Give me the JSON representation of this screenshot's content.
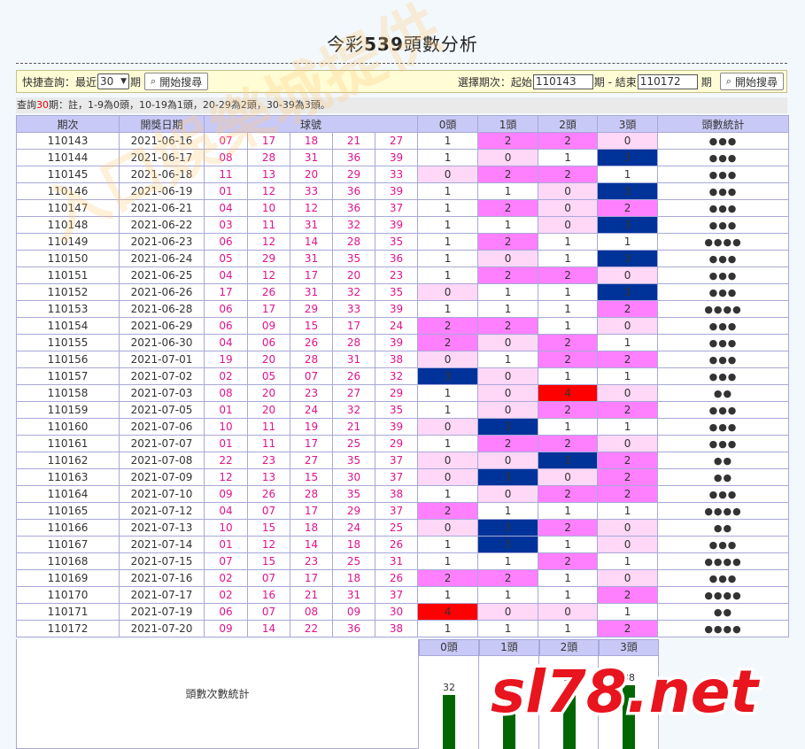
{
  "title": {
    "prefix": "今彩",
    "bold": "539",
    "suffix": "頭數分析"
  },
  "query": {
    "label": "快捷查詢：最近",
    "recent": "30",
    "unit": "期",
    "search_button": "開始搜尋",
    "range_label": "選擇期次：起始",
    "start": "110143",
    "mid_label": "期 - 結束",
    "end": "110172",
    "end_unit": "期"
  },
  "note": {
    "prefix": "查詢",
    "count": "30",
    "text": "期：註，1-9為0頭，10-19為1頭，20-29為2頭，30-39為3頭。"
  },
  "columns": [
    "期次",
    "開獎日期",
    "球號",
    "0頭",
    "1頭",
    "2頭",
    "3頭",
    "頭數統計"
  ],
  "rows": [
    {
      "period": "110143",
      "date": "2021-06-16",
      "balls": [
        "07",
        "17",
        "18",
        "21",
        "27"
      ],
      "c": [
        "1",
        "2",
        "2",
        "0"
      ],
      "s": "●●●"
    },
    {
      "period": "110144",
      "date": "2021-06-17",
      "balls": [
        "08",
        "28",
        "31",
        "36",
        "39"
      ],
      "c": [
        "1",
        "0",
        "1",
        "3"
      ],
      "s": "●●●"
    },
    {
      "period": "110145",
      "date": "2021-06-18",
      "balls": [
        "11",
        "13",
        "20",
        "29",
        "33"
      ],
      "c": [
        "0",
        "2",
        "2",
        "1"
      ],
      "s": "●●●"
    },
    {
      "period": "110146",
      "date": "2021-06-19",
      "balls": [
        "01",
        "12",
        "33",
        "36",
        "39"
      ],
      "c": [
        "1",
        "1",
        "0",
        "3"
      ],
      "s": "●●●"
    },
    {
      "period": "110147",
      "date": "2021-06-21",
      "balls": [
        "04",
        "10",
        "12",
        "36",
        "37"
      ],
      "c": [
        "1",
        "2",
        "0",
        "2"
      ],
      "s": "●●●"
    },
    {
      "period": "110148",
      "date": "2021-06-22",
      "balls": [
        "03",
        "11",
        "31",
        "32",
        "39"
      ],
      "c": [
        "1",
        "1",
        "0",
        "3"
      ],
      "s": "●●●"
    },
    {
      "period": "110149",
      "date": "2021-06-23",
      "balls": [
        "06",
        "12",
        "14",
        "28",
        "35"
      ],
      "c": [
        "1",
        "2",
        "1",
        "1"
      ],
      "s": "●●●●"
    },
    {
      "period": "110150",
      "date": "2021-06-24",
      "balls": [
        "05",
        "29",
        "31",
        "35",
        "36"
      ],
      "c": [
        "1",
        "0",
        "1",
        "3"
      ],
      "s": "●●●"
    },
    {
      "period": "110151",
      "date": "2021-06-25",
      "balls": [
        "04",
        "12",
        "17",
        "20",
        "23"
      ],
      "c": [
        "1",
        "2",
        "2",
        "0"
      ],
      "s": "●●●"
    },
    {
      "period": "110152",
      "date": "2021-06-26",
      "balls": [
        "17",
        "26",
        "31",
        "32",
        "35"
      ],
      "c": [
        "0",
        "1",
        "1",
        "3"
      ],
      "s": "●●●"
    },
    {
      "period": "110153",
      "date": "2021-06-28",
      "balls": [
        "06",
        "17",
        "29",
        "33",
        "39"
      ],
      "c": [
        "1",
        "1",
        "1",
        "2"
      ],
      "s": "●●●●"
    },
    {
      "period": "110154",
      "date": "2021-06-29",
      "balls": [
        "06",
        "09",
        "15",
        "17",
        "24"
      ],
      "c": [
        "2",
        "2",
        "1",
        "0"
      ],
      "s": "●●●"
    },
    {
      "period": "110155",
      "date": "2021-06-30",
      "balls": [
        "04",
        "06",
        "26",
        "28",
        "39"
      ],
      "c": [
        "2",
        "0",
        "2",
        "1"
      ],
      "s": "●●●"
    },
    {
      "period": "110156",
      "date": "2021-07-01",
      "balls": [
        "19",
        "20",
        "28",
        "31",
        "38"
      ],
      "c": [
        "0",
        "1",
        "2",
        "2"
      ],
      "s": "●●●"
    },
    {
      "period": "110157",
      "date": "2021-07-02",
      "balls": [
        "02",
        "05",
        "07",
        "26",
        "32"
      ],
      "c": [
        "3",
        "0",
        "1",
        "1"
      ],
      "s": "●●●"
    },
    {
      "period": "110158",
      "date": "2021-07-03",
      "balls": [
        "08",
        "20",
        "23",
        "27",
        "29"
      ],
      "c": [
        "1",
        "0",
        "4",
        "0"
      ],
      "s": "●●"
    },
    {
      "period": "110159",
      "date": "2021-07-05",
      "balls": [
        "01",
        "20",
        "24",
        "32",
        "35"
      ],
      "c": [
        "1",
        "0",
        "2",
        "2"
      ],
      "s": "●●●"
    },
    {
      "period": "110160",
      "date": "2021-07-06",
      "balls": [
        "10",
        "11",
        "19",
        "21",
        "39"
      ],
      "c": [
        "0",
        "3",
        "1",
        "1"
      ],
      "s": "●●●"
    },
    {
      "period": "110161",
      "date": "2021-07-07",
      "balls": [
        "01",
        "11",
        "17",
        "25",
        "29"
      ],
      "c": [
        "1",
        "2",
        "2",
        "0"
      ],
      "s": "●●●"
    },
    {
      "period": "110162",
      "date": "2021-07-08",
      "balls": [
        "22",
        "23",
        "27",
        "35",
        "37"
      ],
      "c": [
        "0",
        "0",
        "3",
        "2"
      ],
      "s": "●●"
    },
    {
      "period": "110163",
      "date": "2021-07-09",
      "balls": [
        "12",
        "13",
        "15",
        "30",
        "37"
      ],
      "c": [
        "0",
        "3",
        "0",
        "2"
      ],
      "s": "●●"
    },
    {
      "period": "110164",
      "date": "2021-07-10",
      "balls": [
        "09",
        "26",
        "28",
        "35",
        "38"
      ],
      "c": [
        "1",
        "0",
        "2",
        "2"
      ],
      "s": "●●●"
    },
    {
      "period": "110165",
      "date": "2021-07-12",
      "balls": [
        "04",
        "07",
        "17",
        "29",
        "37"
      ],
      "c": [
        "2",
        "1",
        "1",
        "1"
      ],
      "s": "●●●●"
    },
    {
      "period": "110166",
      "date": "2021-07-13",
      "balls": [
        "10",
        "15",
        "18",
        "24",
        "25"
      ],
      "c": [
        "0",
        "3",
        "2",
        "0"
      ],
      "s": "●●"
    },
    {
      "period": "110167",
      "date": "2021-07-14",
      "balls": [
        "01",
        "12",
        "14",
        "18",
        "26"
      ],
      "c": [
        "1",
        "3",
        "1",
        "0"
      ],
      "s": "●●●"
    },
    {
      "period": "110168",
      "date": "2021-07-15",
      "balls": [
        "07",
        "15",
        "23",
        "25",
        "31"
      ],
      "c": [
        "1",
        "1",
        "2",
        "1"
      ],
      "s": "●●●●"
    },
    {
      "period": "110169",
      "date": "2021-07-16",
      "balls": [
        "02",
        "07",
        "17",
        "18",
        "26"
      ],
      "c": [
        "2",
        "2",
        "1",
        "0"
      ],
      "s": "●●●"
    },
    {
      "period": "110170",
      "date": "2021-07-17",
      "balls": [
        "02",
        "16",
        "21",
        "31",
        "37"
      ],
      "c": [
        "1",
        "1",
        "1",
        "2"
      ],
      "s": "●●●●"
    },
    {
      "period": "110171",
      "date": "2021-07-19",
      "balls": [
        "06",
        "07",
        "08",
        "09",
        "30"
      ],
      "c": [
        "4",
        "0",
        "0",
        "1"
      ],
      "s": "●●"
    },
    {
      "period": "110172",
      "date": "2021-07-20",
      "balls": [
        "09",
        "14",
        "22",
        "36",
        "38"
      ],
      "c": [
        "1",
        "1",
        "1",
        "2"
      ],
      "s": "●●●●"
    }
  ],
  "stats": {
    "label": "頭數次數統計",
    "heads": [
      "0頭",
      "1頭",
      "2頭",
      "3頭"
    ],
    "counts": [
      32,
      36,
      34,
      38
    ],
    "bar_color": "#006600"
  },
  "watermark": "入口娛樂城提供",
  "logo": "sl78.net"
}
